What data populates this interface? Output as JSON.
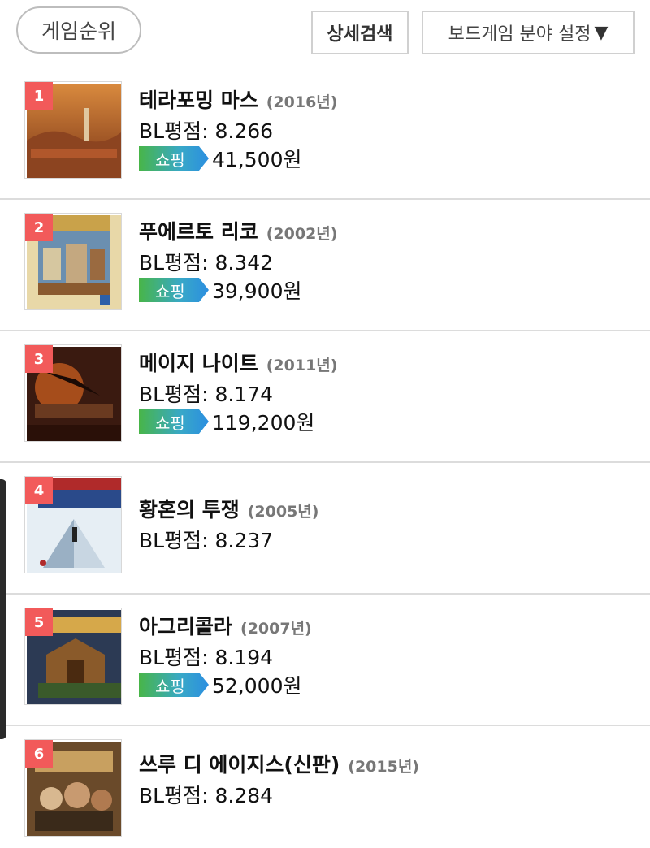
{
  "header": {
    "rank_tab": "게임순위",
    "detail_search": "상세검색",
    "genre_setting": "보드게임 분야 설정",
    "genre_caret": "▼"
  },
  "items": [
    {
      "rank": "1",
      "title": "테라포밍 마스",
      "year": "(2016년)",
      "score": "BL평점: 8.266",
      "shop": "쇼핑",
      "price": "41,500원"
    },
    {
      "rank": "2",
      "title": "푸에르토 리코",
      "year": "(2002년)",
      "score": "BL평점: 8.342",
      "shop": "쇼핑",
      "price": "39,900원"
    },
    {
      "rank": "3",
      "title": "메이지 나이트",
      "year": "(2011년)",
      "score": "BL평점: 8.174",
      "shop": "쇼핑",
      "price": "119,200원"
    },
    {
      "rank": "4",
      "title": "황혼의 투쟁",
      "year": "(2005년)",
      "score": "BL평점: 8.237"
    },
    {
      "rank": "5",
      "title": "아그리콜라",
      "year": "(2007년)",
      "score": "BL평점: 8.194",
      "shop": "쇼핑",
      "price": "52,000원"
    },
    {
      "rank": "6",
      "title": "쓰루 디 에이지스(신판)",
      "year": "(2015년)",
      "score": "BL평점: 8.284"
    }
  ],
  "colors": {
    "rank_badge": "#f25a5a",
    "shop_badge_start": "#48b548",
    "shop_badge_end": "#2b8ee0"
  }
}
